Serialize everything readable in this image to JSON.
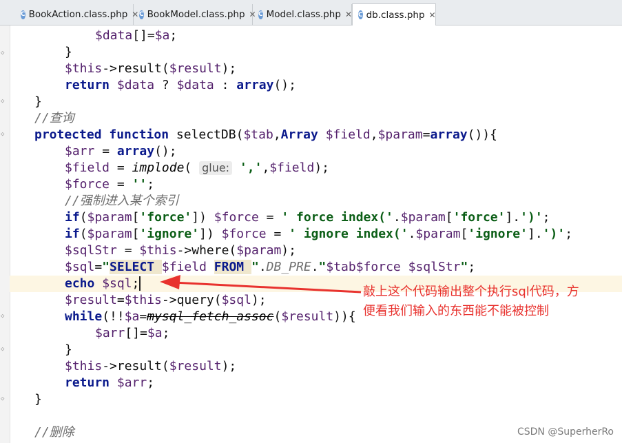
{
  "tabs": [
    {
      "icon": "C",
      "label": "BookAction.class.php",
      "active": false
    },
    {
      "icon": "C",
      "label": "BookModel.class.php",
      "active": false
    },
    {
      "icon": "C",
      "label": "Model.class.php",
      "active": false
    },
    {
      "icon": "C",
      "label": "db.class.php",
      "active": true
    }
  ],
  "tab_close_glyph": "✕",
  "code": {
    "l1": {
      "a": "$data",
      "b": "[]=",
      "c": "$a",
      "d": ";"
    },
    "l2": {
      "a": "}"
    },
    "l3": {
      "a": "$this",
      "b": "->result(",
      "c": "$result",
      "d": ");"
    },
    "l4": {
      "a": "return ",
      "b": "$data",
      "c": " ? ",
      "d": "$data",
      "e": " : ",
      "f": "array",
      "g": "();"
    },
    "l5": {
      "a": "}"
    },
    "l6": {
      "a": "//查询"
    },
    "l7": {
      "a": "protected function ",
      "b": "selectDB(",
      "c": "$tab",
      "d": ",",
      "e": "Array ",
      "f": "$field",
      "g": ",",
      "h": "$param",
      "i": "=",
      "j": "array",
      "k": "()){"
    },
    "l8": {
      "a": "$arr",
      "b": " = ",
      "c": "array",
      "d": "();"
    },
    "l9": {
      "a": "$field",
      "b": " = ",
      "c": "implode",
      "d": "( ",
      "hint": "glue:",
      "e": " ','",
      "f": ",",
      "g": "$field",
      "h": ");"
    },
    "l10": {
      "a": "$force",
      "b": " = ",
      "c": "''",
      "d": ";"
    },
    "l11": {
      "a": "//强制进入某个索引"
    },
    "l12": {
      "a": "if",
      "b": "(",
      "c": "$param",
      "d": "[",
      "e": "'force'",
      "f": "]) ",
      "g": "$force",
      "h": " = ",
      "i": "' force index('",
      "j": ".",
      "k": "$param",
      "l": "[",
      "m": "'force'",
      "n": "].",
      "o": "')'",
      "p": ";"
    },
    "l13": {
      "a": "if",
      "b": "(",
      "c": "$param",
      "d": "[",
      "e": "'ignore'",
      "f": "]) ",
      "g": "$force",
      "h": " = ",
      "i": "' ignore index('",
      "j": ".",
      "k": "$param",
      "l": "[",
      "m": "'ignore'",
      "n": "].",
      "o": "')'",
      "p": ";"
    },
    "l14": {
      "a": "$sqlStr",
      "b": " = ",
      "c": "$this",
      "d": "->where(",
      "e": "$param",
      "f": ");"
    },
    "l15": {
      "a": "$sql",
      "b": "=",
      "c": "\"",
      "d": "SELECT ",
      "e": "$field",
      "f": " ",
      "g": "FROM ",
      "h": "\"",
      "i": ".",
      "j": "DB_PRE",
      "k": ".",
      "l": "\"",
      "m": "$tab",
      "n": "$force",
      "o": " ",
      "p": "$sqlStr",
      "q": "\"",
      "r": ";"
    },
    "l16": {
      "a": "echo ",
      "b": "$sql",
      "c": ";"
    },
    "l17": {
      "a": "$result",
      "b": "=",
      "c": "$this",
      "d": "->query(",
      "e": "$sql",
      "f": ");"
    },
    "l18": {
      "a": "while",
      "b": "(!!",
      "c": "$a",
      "d": "=",
      "e": "mysql_fetch_assoc",
      "f": "(",
      "g": "$result",
      "h": ")){"
    },
    "l19": {
      "a": "$arr",
      "b": "[]=",
      "c": "$a",
      "d": ";"
    },
    "l20": {
      "a": "}"
    },
    "l21": {
      "a": "$this",
      "b": "->result(",
      "c": "$result",
      "d": ");"
    },
    "l22": {
      "a": "return ",
      "b": "$arr",
      "c": ";"
    },
    "l23": {
      "a": "}"
    },
    "l24": {
      "a": "//删除"
    }
  },
  "annotation": {
    "line1": "敲上这个代码输出整个执行sql代码，方",
    "line2": "便看我们输入的东西能不能被控制",
    "color": "#e8322e"
  },
  "watermark": "CSDN @SuperherRo"
}
